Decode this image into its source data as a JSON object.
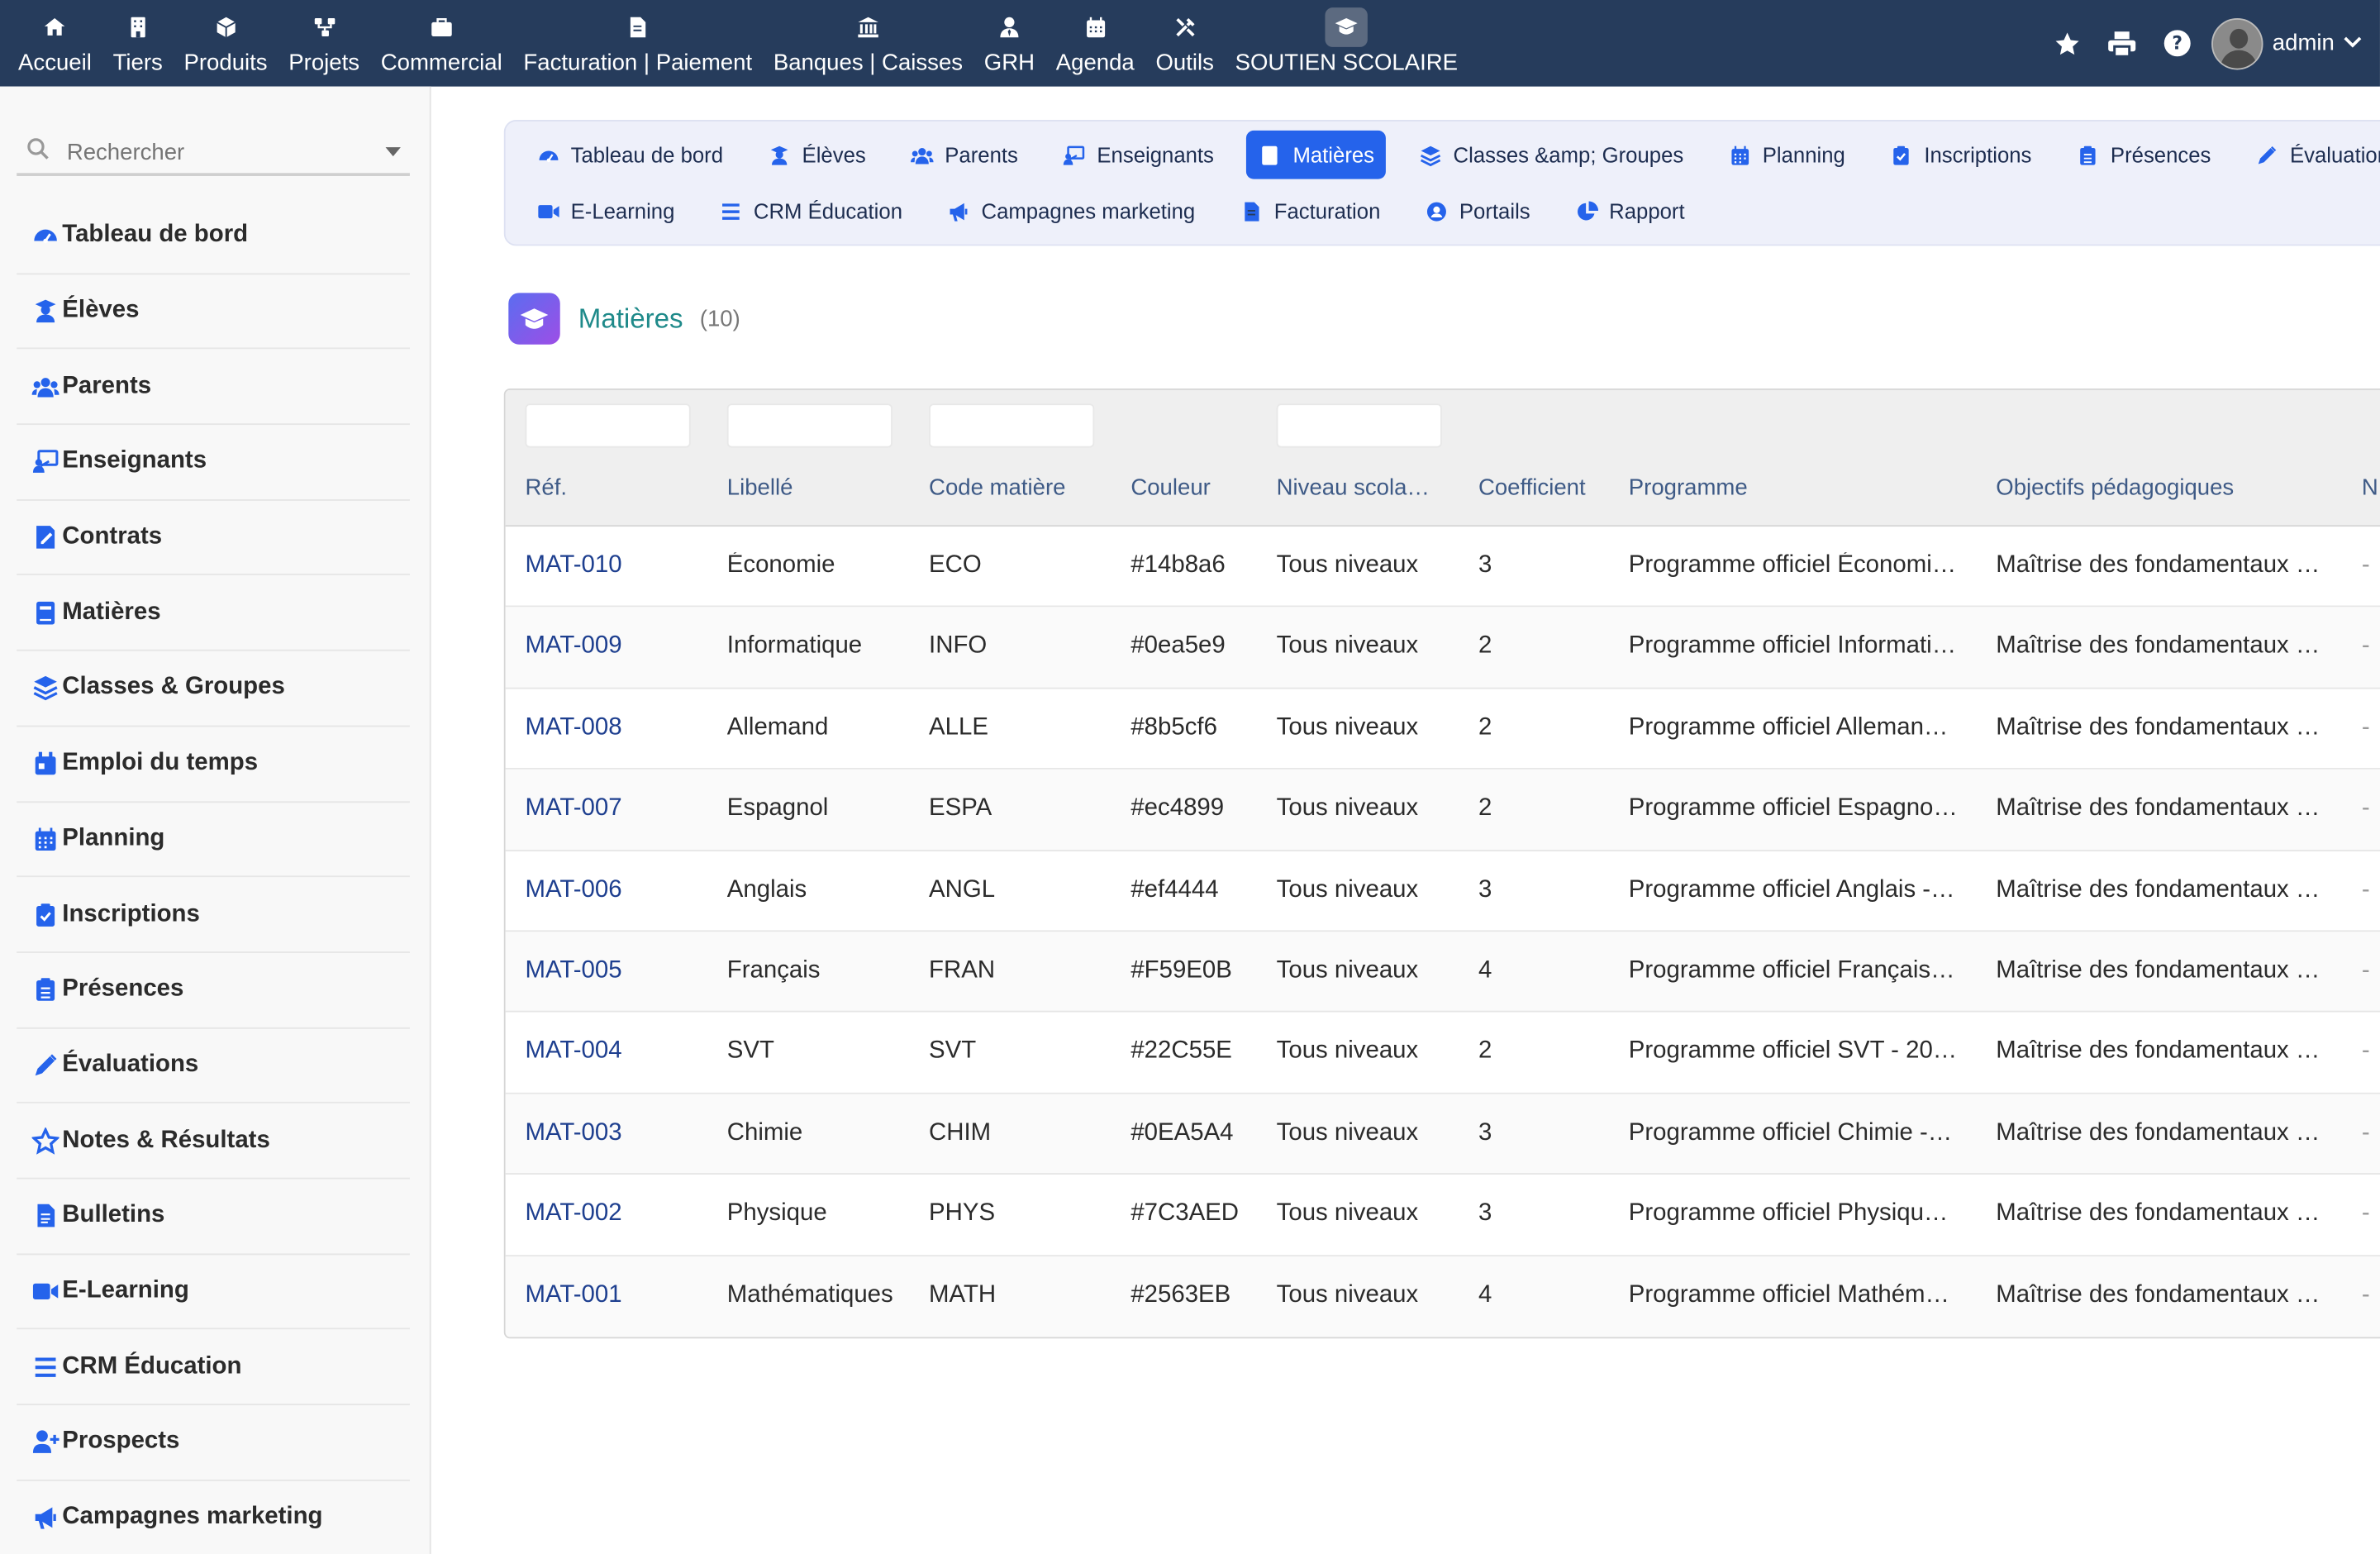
{
  "topbar": {
    "menu": [
      {
        "label": "Accueil",
        "icon": "home-icon"
      },
      {
        "label": "Tiers",
        "icon": "building-icon"
      },
      {
        "label": "Produits",
        "icon": "cube-icon"
      },
      {
        "label": "Projets",
        "icon": "project-icon"
      },
      {
        "label": "Commercial",
        "icon": "briefcase-icon"
      },
      {
        "label": "Facturation | Paiement",
        "icon": "invoice-icon"
      },
      {
        "label": "Banques | Caisses",
        "icon": "bank-icon"
      },
      {
        "label": "GRH",
        "icon": "user-tie-icon"
      },
      {
        "label": "Agenda",
        "icon": "calendar-icon"
      },
      {
        "label": "Outils",
        "icon": "tools-icon"
      },
      {
        "label": "SOUTIEN SCOLAIRE",
        "icon": "graduation-cap-icon"
      }
    ],
    "user": "admin"
  },
  "sidebar": {
    "search_placeholder": "Rechercher",
    "items": [
      {
        "label": "Tableau de bord",
        "icon": "dashboard-icon"
      },
      {
        "label": "Élèves",
        "icon": "student-icon"
      },
      {
        "label": "Parents",
        "icon": "users-icon"
      },
      {
        "label": "Enseignants",
        "icon": "teacher-icon"
      },
      {
        "label": "Contrats",
        "icon": "contract-icon"
      },
      {
        "label": "Matières",
        "icon": "book-icon"
      },
      {
        "label": "Classes & Groupes",
        "icon": "layers-icon"
      },
      {
        "label": "Emploi du temps",
        "icon": "calendar-day-icon"
      },
      {
        "label": "Planning",
        "icon": "calendar-grid-icon"
      },
      {
        "label": "Inscriptions",
        "icon": "clipboard-check-icon"
      },
      {
        "label": "Présences",
        "icon": "clipboard-list-icon"
      },
      {
        "label": "Évaluations",
        "icon": "pencil-icon"
      },
      {
        "label": "Notes & Résultats",
        "icon": "star-outline-icon"
      },
      {
        "label": "Bulletins",
        "icon": "file-icon"
      },
      {
        "label": "E-Learning",
        "icon": "video-icon"
      },
      {
        "label": "CRM Éducation",
        "icon": "list-icon"
      },
      {
        "label": "Prospects",
        "icon": "user-plus-icon"
      },
      {
        "label": "Campagnes marketing",
        "icon": "bullhorn-icon"
      }
    ]
  },
  "tabs": {
    "row1": [
      {
        "label": "Tableau de bord",
        "icon": "dashboard-icon"
      },
      {
        "label": "Élèves",
        "icon": "student-icon"
      },
      {
        "label": "Parents",
        "icon": "users-icon"
      },
      {
        "label": "Enseignants",
        "icon": "teacher-icon"
      },
      {
        "label": "Matières",
        "icon": "book-icon",
        "active": true
      },
      {
        "label": "Classes &amp; Groupes",
        "icon": "layers-icon"
      },
      {
        "label": "Planning",
        "icon": "calendar-grid-icon"
      },
      {
        "label": "Inscriptions",
        "icon": "clipboard-check-icon"
      },
      {
        "label": "Présences",
        "icon": "clipboard-list-icon"
      },
      {
        "label": "Évaluations",
        "icon": "pencil-icon"
      }
    ],
    "row2": [
      {
        "label": "E-Learning",
        "icon": "video-icon"
      },
      {
        "label": "CRM Éducation",
        "icon": "list-icon"
      },
      {
        "label": "Campagnes marketing",
        "icon": "bullhorn-icon"
      },
      {
        "label": "Facturation",
        "icon": "invoice-icon"
      },
      {
        "label": "Portails",
        "icon": "user-circle-icon"
      },
      {
        "label": "Rapport",
        "icon": "pie-chart-icon"
      }
    ]
  },
  "page": {
    "title": "Matières",
    "count": "(10)"
  },
  "table": {
    "columns": [
      "Réf.",
      "Libellé",
      "Code matière",
      "Couleur",
      "Niveau scola…",
      "Coefficient",
      "Programme",
      "Objectifs pédagogiques",
      "N"
    ],
    "rows": [
      [
        "MAT-010",
        "Économie",
        "ECO",
        "#14b8a6",
        "Tous niveaux",
        "3",
        "Programme officiel Économi…",
        "Maîtrise des fondamentaux …",
        "-"
      ],
      [
        "MAT-009",
        "Informatique",
        "INFO",
        "#0ea5e9",
        "Tous niveaux",
        "2",
        "Programme officiel Informati…",
        "Maîtrise des fondamentaux …",
        "-"
      ],
      [
        "MAT-008",
        "Allemand",
        "ALLE",
        "#8b5cf6",
        "Tous niveaux",
        "2",
        "Programme officiel Alleman…",
        "Maîtrise des fondamentaux …",
        "-"
      ],
      [
        "MAT-007",
        "Espagnol",
        "ESPA",
        "#ec4899",
        "Tous niveaux",
        "2",
        "Programme officiel Espagno…",
        "Maîtrise des fondamentaux …",
        "-"
      ],
      [
        "MAT-006",
        "Anglais",
        "ANGL",
        "#ef4444",
        "Tous niveaux",
        "3",
        "Programme officiel Anglais -…",
        "Maîtrise des fondamentaux …",
        "-"
      ],
      [
        "MAT-005",
        "Français",
        "FRAN",
        "#F59E0B",
        "Tous niveaux",
        "4",
        "Programme officiel Français…",
        "Maîtrise des fondamentaux …",
        "-"
      ],
      [
        "MAT-004",
        "SVT",
        "SVT",
        "#22C55E",
        "Tous niveaux",
        "2",
        "Programme officiel SVT - 20…",
        "Maîtrise des fondamentaux …",
        "-"
      ],
      [
        "MAT-003",
        "Chimie",
        "CHIM",
        "#0EA5A4",
        "Tous niveaux",
        "3",
        "Programme officiel Chimie -…",
        "Maîtrise des fondamentaux …",
        "-"
      ],
      [
        "MAT-002",
        "Physique",
        "PHYS",
        "#7C3AED",
        "Tous niveaux",
        "3",
        "Programme officiel Physiqu…",
        "Maîtrise des fondamentaux …",
        "-"
      ],
      [
        "MAT-001",
        "Mathématiques",
        "MATH",
        "#2563EB",
        "Tous niveaux",
        "4",
        "Programme officiel Mathém…",
        "Maîtrise des fondamentaux …",
        "-"
      ]
    ]
  },
  "colors": {
    "topbar": "#263c5c",
    "accent": "#2563eb",
    "title": "#1f8a8a",
    "link": "#1e3f8f"
  }
}
